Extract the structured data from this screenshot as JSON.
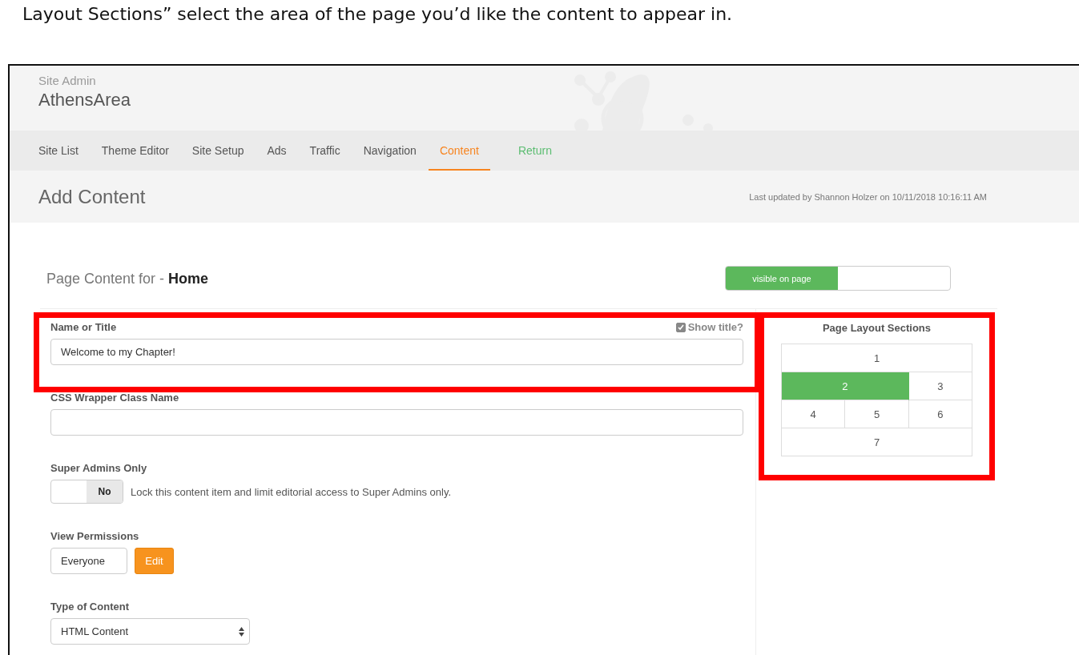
{
  "caption": "Layout Sections” select the area of the page you’d like the content to appear in.",
  "header": {
    "subtitle": "Site Admin",
    "title": "AthensArea"
  },
  "nav": [
    {
      "label": "Site List",
      "selected": false,
      "kind": "tab"
    },
    {
      "label": "Theme Editor",
      "selected": false,
      "kind": "tab"
    },
    {
      "label": "Site Setup",
      "selected": false,
      "kind": "tab"
    },
    {
      "label": "Ads",
      "selected": false,
      "kind": "tab"
    },
    {
      "label": "Traffic",
      "selected": false,
      "kind": "tab"
    },
    {
      "label": "Navigation",
      "selected": false,
      "kind": "tab"
    },
    {
      "label": "Content",
      "selected": true,
      "kind": "tab"
    },
    {
      "label": "Return",
      "selected": false,
      "kind": "return"
    }
  ],
  "page_title": "Add Content",
  "last_updated": "Last updated by Shannon Holzer on 10/11/2018 10:16:11 AM",
  "page_content_for": "Page Content for - **Home**",
  "visibility": {
    "label": "visible on page",
    "on": true
  },
  "name_field": {
    "label": "Name or Title",
    "value": "Welcome to my Chapter!",
    "show_title": {
      "label": "Show title?",
      "checked": true
    }
  },
  "css_field": {
    "label": "CSS Wrapper Class Name"
  },
  "super_admins": {
    "label": "Super Admins Only",
    "switch_label": "No",
    "on": false,
    "description": "Lock this content item and limit editorial access to Super Admins only."
  },
  "view_permissions": {
    "label": "View Permissions",
    "value": "Everyone",
    "button": "Edit"
  },
  "content_type": {
    "label": "Type of Content",
    "value": "HTML Content"
  },
  "layout_sections": {
    "title": "Page Layout Sections",
    "sections": [
      {
        "label": "1",
        "selected": false
      },
      {
        "label": "2",
        "selected": true
      },
      {
        "label": "3",
        "selected": false
      },
      {
        "label": "4",
        "selected": false
      },
      {
        "label": "5",
        "selected": false
      },
      {
        "label": "6",
        "selected": false
      },
      {
        "label": "7",
        "selected": false
      }
    ]
  }
}
